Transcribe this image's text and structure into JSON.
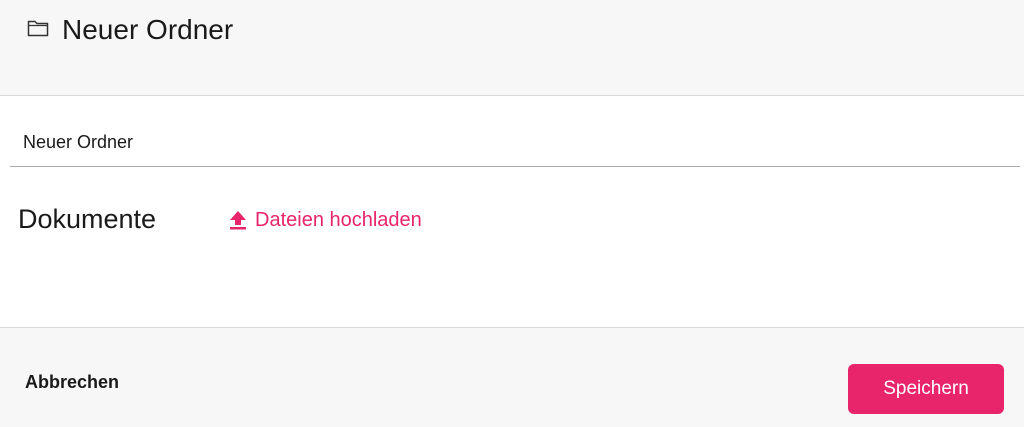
{
  "header": {
    "icon": "folder-icon",
    "title": "Neuer Ordner"
  },
  "name_field": {
    "value": "Neuer Ordner"
  },
  "documents": {
    "label": "Dokumente",
    "upload_icon": "upload-icon",
    "upload_label": "Dateien hochladen"
  },
  "footer": {
    "cancel_label": "Abbrechen",
    "save_label": "Speichern"
  },
  "colors": {
    "accent": "#e8246a",
    "panel_background": "#f7f7f7",
    "divider": "#d8d8d8"
  }
}
